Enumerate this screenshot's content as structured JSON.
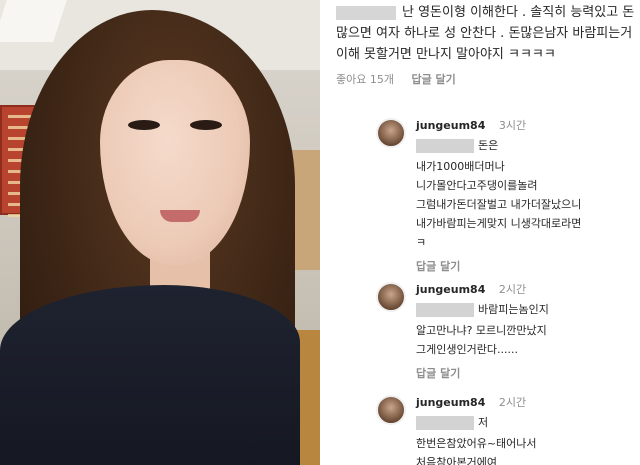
{
  "top_comment": {
    "text": "난 영돈이형 이해한다 . 솔직히 능력있고 돈많으면 여자 하나로 성 안찬다 . 돈많은남자 바람피는거 이해 못할거면 만나지 말아야지 ㅋㅋㅋㅋ",
    "likes": "좋아요 15개",
    "reply": "답글 달기"
  },
  "replies": [
    {
      "user": "jungeum84",
      "time": "3시간",
      "lead": "돈은",
      "text": "내가1000배더머나\n니가몰안다고주댕이를놀려\n그럼내가돈더잘벌고 내가더잘났으니\n내가바람피는게맞지 니생각대로라면\nㅋ",
      "reply": "답글 달기",
      "avatar_icon": "profile-avatar"
    },
    {
      "user": "jungeum84",
      "time": "2시간",
      "lead": "바람피는놈인지",
      "text": "알고만나냐? 모르니깐만났지\n그게인생인거란다......",
      "reply": "답글 달기",
      "avatar_icon": "profile-avatar"
    },
    {
      "user": "jungeum84",
      "time": "2시간",
      "lead": "저",
      "text": "한번은참았어유~태어나서\n처음참아본거에여",
      "reply": "",
      "avatar_icon": "profile-avatar"
    }
  ]
}
